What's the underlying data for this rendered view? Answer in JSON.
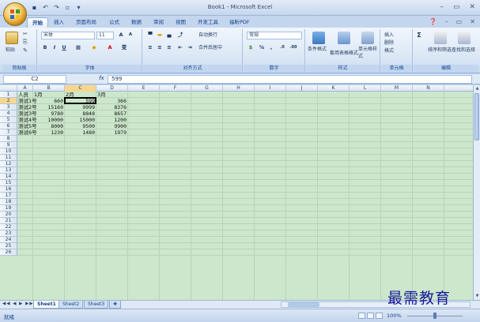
{
  "window": {
    "title": "Book1 - Microsoft Excel",
    "controls": [
      "–",
      "▭",
      "✕"
    ]
  },
  "ribbon_tabs": [
    "开始",
    "插入",
    "页面布局",
    "公式",
    "数据",
    "审阅",
    "视图",
    "开发工具",
    "福昕PDF"
  ],
  "active_tab": "开始",
  "ribbon": {
    "clipboard": {
      "paste": "粘贴",
      "label": "剪贴板"
    },
    "font": {
      "name": "宋体",
      "size": "11",
      "label": "字体",
      "bold": "B",
      "italic": "I",
      "underline": "U",
      "color_letter": "A",
      "phonetic": "变"
    },
    "alignment": {
      "wrap": "自动换行",
      "merge": "合并后居中",
      "label": "对齐方式"
    },
    "number": {
      "format": "常规",
      "label": "数字",
      "percent": "%",
      "comma": ","
    },
    "styles": {
      "conditional": "条件格式",
      "table": "套用表格格式",
      "cell": "单元格样式",
      "label": "样式"
    },
    "cells": {
      "insert": "插入",
      "delete": "删除",
      "format": "格式",
      "label": "单元格"
    },
    "editing": {
      "sum": "Σ",
      "sort": "排序和筛选",
      "find": "查找和选择",
      "label": "编辑"
    }
  },
  "formula_bar": {
    "name_box": "C2",
    "fx": "fx",
    "value": "599"
  },
  "columns": [
    "A",
    "B",
    "C",
    "D",
    "E",
    "F",
    "G",
    "H",
    "I",
    "J",
    "K",
    "L",
    "M",
    "N"
  ],
  "selected_column": "C",
  "rows": [
    "1",
    "2",
    "3",
    "4",
    "5",
    "6",
    "7",
    "8",
    "9",
    "10",
    "11",
    "12",
    "13",
    "14",
    "15",
    "16",
    "17",
    "18",
    "19",
    "20",
    "21",
    "22",
    "23",
    "24",
    "25",
    "26"
  ],
  "selected_row": "2",
  "sheet": {
    "headers": [
      "人员",
      "1月",
      "2月",
      "3月"
    ],
    "data": [
      [
        "测试1号",
        "660",
        "599",
        "366"
      ],
      [
        "测试2号",
        "15160",
        "9999",
        "8376"
      ],
      [
        "测试3号",
        "9780",
        "8848",
        "8657"
      ],
      [
        "测试4号",
        "10000",
        "15000",
        "1200"
      ],
      [
        "测试5号",
        "8000",
        "9500",
        "9900"
      ],
      [
        "测试6号",
        "1230",
        "1480",
        "1979"
      ]
    ]
  },
  "sheet_tabs": [
    "Sheet1",
    "Sheet2",
    "Sheet3"
  ],
  "active_sheet": "Sheet1",
  "status": {
    "ready": "就绪",
    "zoom": "100%"
  },
  "watermark": "最需教育"
}
